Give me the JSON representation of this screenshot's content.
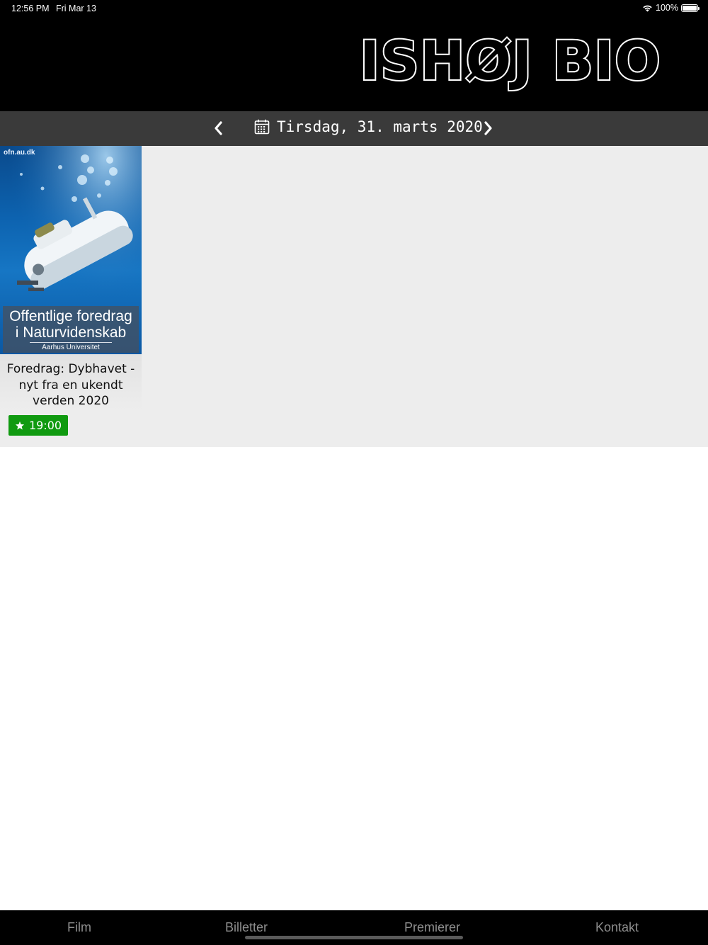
{
  "status_bar": {
    "time": "12:56 PM",
    "date": "Fri Mar 13",
    "battery": "100%"
  },
  "header": {
    "logo": "ISHØJ BIO"
  },
  "date_nav": {
    "date": "Tirsdag, 31. marts 2020"
  },
  "movies": [
    {
      "poster": {
        "source_label": "ofn.au.dk",
        "caption_line1": "Offentlige foredrag",
        "caption_line2": "i Naturvidenskab",
        "caption_line3": "Aarhus Universitet"
      },
      "title": "Foredrag: Dybhavet - nyt fra en ukendt verden 2020",
      "showtimes": [
        "19:00"
      ]
    }
  ],
  "tabs": [
    "Film",
    "Billetter",
    "Premierer",
    "Kontakt"
  ],
  "colors": {
    "header_bg": "#000000",
    "datebar_bg": "#3a3a3a",
    "content_bg": "#ededed",
    "showtime_bg": "#109a10",
    "tab_text": "#8e8e8e"
  }
}
